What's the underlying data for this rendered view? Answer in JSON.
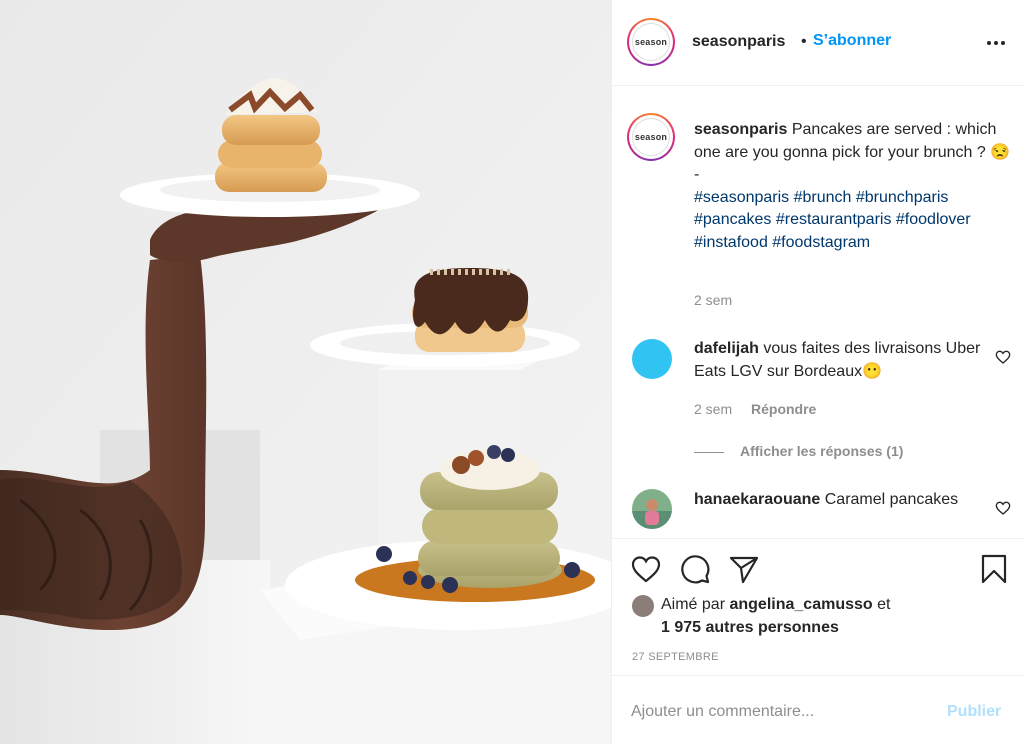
{
  "post": {
    "username": "seasonparis",
    "avatar_text": "season",
    "follow_label": "S’abonner",
    "separator": "•",
    "more_icon": "more-horizontal-icon"
  },
  "caption": {
    "username": "seasonparis",
    "text": "Pancakes are served : which one are you gonna pick for your brunch ? 😒",
    "dash": "-",
    "hashtags": "#seasonparis #brunch #brunchparis #pancakes #restaurantparis #foodlover #instafood #foodstagram",
    "age": "2 sem"
  },
  "comments": [
    {
      "username": "dafelijah",
      "text": "vous faites des livraisons Uber Eats LGV sur Bordeaux😶",
      "age": "2 sem",
      "reply_label": "Répondre",
      "view_replies": "Afficher les réponses (1)",
      "avatar_color": "#31c4f3"
    },
    {
      "username": "hanaekaraouane",
      "text": "Caramel pancakes"
    }
  ],
  "actions": {
    "like_icon": "heart-icon",
    "comment_icon": "comment-icon",
    "share_icon": "paper-plane-icon",
    "save_icon": "bookmark-icon"
  },
  "likes": {
    "prefix": "Aimé par",
    "liker": "angelina_camusso",
    "conj": "et",
    "others": "1 975 autres personnes"
  },
  "date": "27 SEPTEMBRE",
  "add_comment": {
    "placeholder": "Ajouter un commentaire...",
    "publish_label": "Publier"
  },
  "colors": {
    "accent": "#0095f6",
    "hashtag": "#00376b",
    "muted": "#8e8e8e",
    "publish_disabled": "#b2dffc"
  }
}
